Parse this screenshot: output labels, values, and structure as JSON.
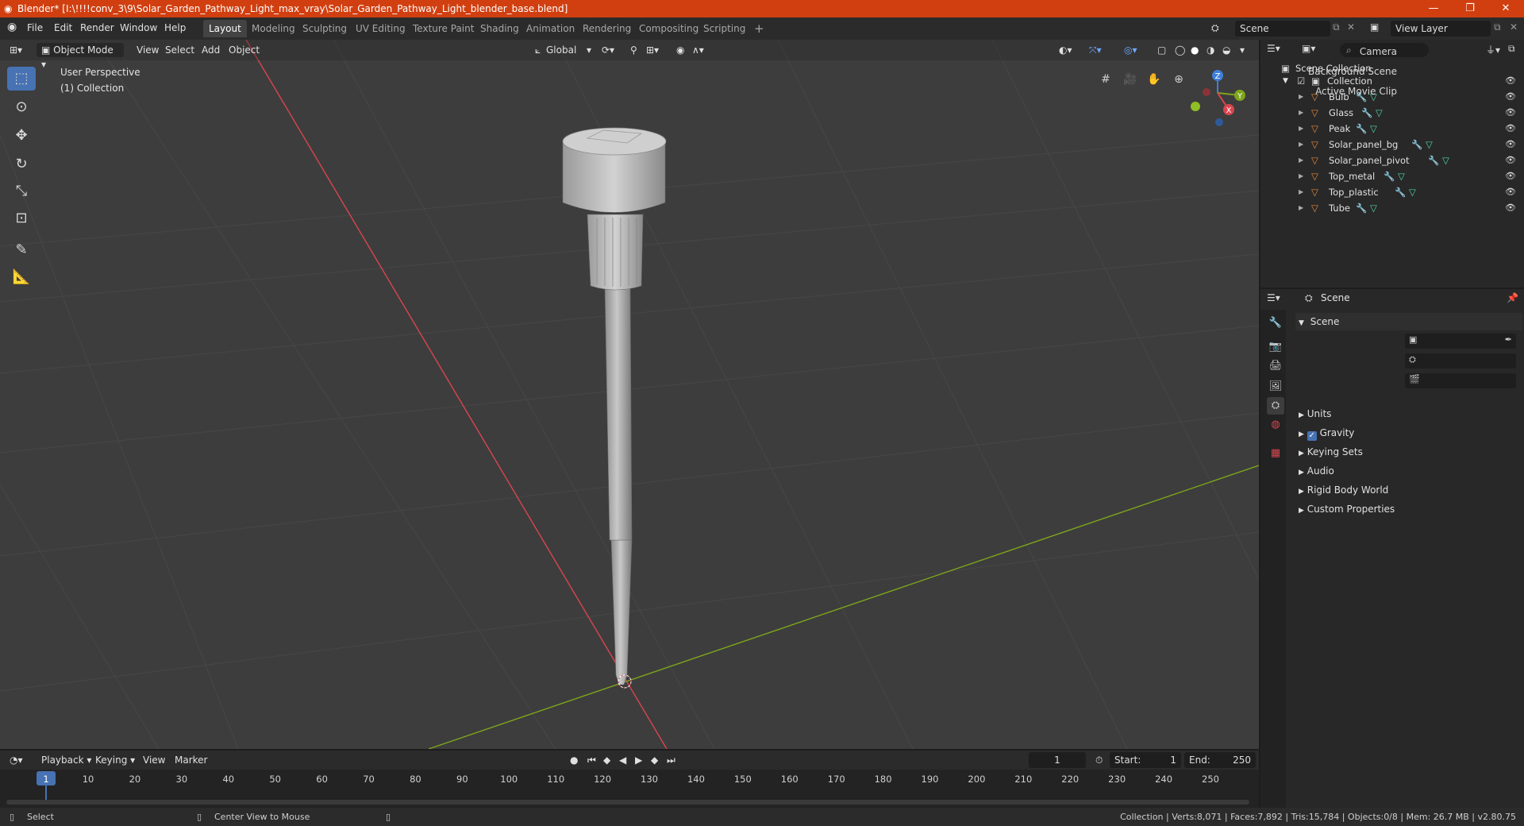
{
  "window": {
    "title": "Blender* [I:\\!!!!conv_3\\9\\Solar_Garden_Pathway_Light_max_vray\\Solar_Garden_Pathway_Light_blender_base.blend]",
    "minimize": "—",
    "maximize": "❐",
    "close": "✕"
  },
  "menu": {
    "items": [
      "File",
      "Edit",
      "Render",
      "Window",
      "Help"
    ],
    "workspaces": [
      "Layout",
      "Modeling",
      "Sculpting",
      "UV Editing",
      "Texture Paint",
      "Shading",
      "Animation",
      "Rendering",
      "Compositing",
      "Scripting"
    ],
    "active_workspace": "Layout",
    "add_tab": "+",
    "scene": "Scene",
    "view_layer": "View Layer"
  },
  "viewport": {
    "mode": "Object Mode",
    "menus": [
      "View",
      "Select",
      "Add",
      "Object"
    ],
    "orientation": "Global",
    "perspective_label": "User Perspective",
    "collection_label": "(1) Collection",
    "gizmo": {
      "z": "Z",
      "y": "Y",
      "x": "X"
    }
  },
  "outliner": {
    "root": "Scene Collection",
    "collection": "Collection",
    "objects": [
      "Bulb",
      "Glass",
      "Peak",
      "Solar_panel_bg",
      "Solar_panel_pivot",
      "Top_metal",
      "Top_plastic",
      "Tube"
    ]
  },
  "properties": {
    "context": "Scene",
    "panel": "Scene",
    "fields": [
      {
        "label": "Camera"
      },
      {
        "label": "Background Scene"
      },
      {
        "label": "Active Movie Clip"
      }
    ],
    "sections": [
      "Units",
      "Gravity",
      "Keying Sets",
      "Audio",
      "Rigid Body World",
      "Custom Properties"
    ],
    "gravity_checked": true
  },
  "timeline": {
    "menus": [
      "Playback",
      "Keying",
      "View",
      "Marker"
    ],
    "current_frame": "1",
    "start_label": "Start:",
    "start": "1",
    "end_label": "End:",
    "end": "250",
    "ticks": [
      "1",
      "10",
      "20",
      "30",
      "40",
      "50",
      "60",
      "70",
      "80",
      "90",
      "100",
      "110",
      "120",
      "130",
      "140",
      "150",
      "160",
      "170",
      "180",
      "190",
      "200",
      "210",
      "220",
      "230",
      "240",
      "250"
    ]
  },
  "status": {
    "left_action": "Select",
    "middle_action": "Center View to Mouse",
    "stats": "Collection | Verts:8,071 | Faces:7,892 | Tris:15,784 | Objects:0/8 | Mem: 26.7 MB | v2.80.75"
  },
  "colors": {
    "titlebar": "#d13f10",
    "accent": "#4772b3",
    "object_icon": "#e58a3a",
    "mesh_icon": "#4fd4a8",
    "axis_x": "#d9454f",
    "axis_y": "#7ea51b"
  }
}
